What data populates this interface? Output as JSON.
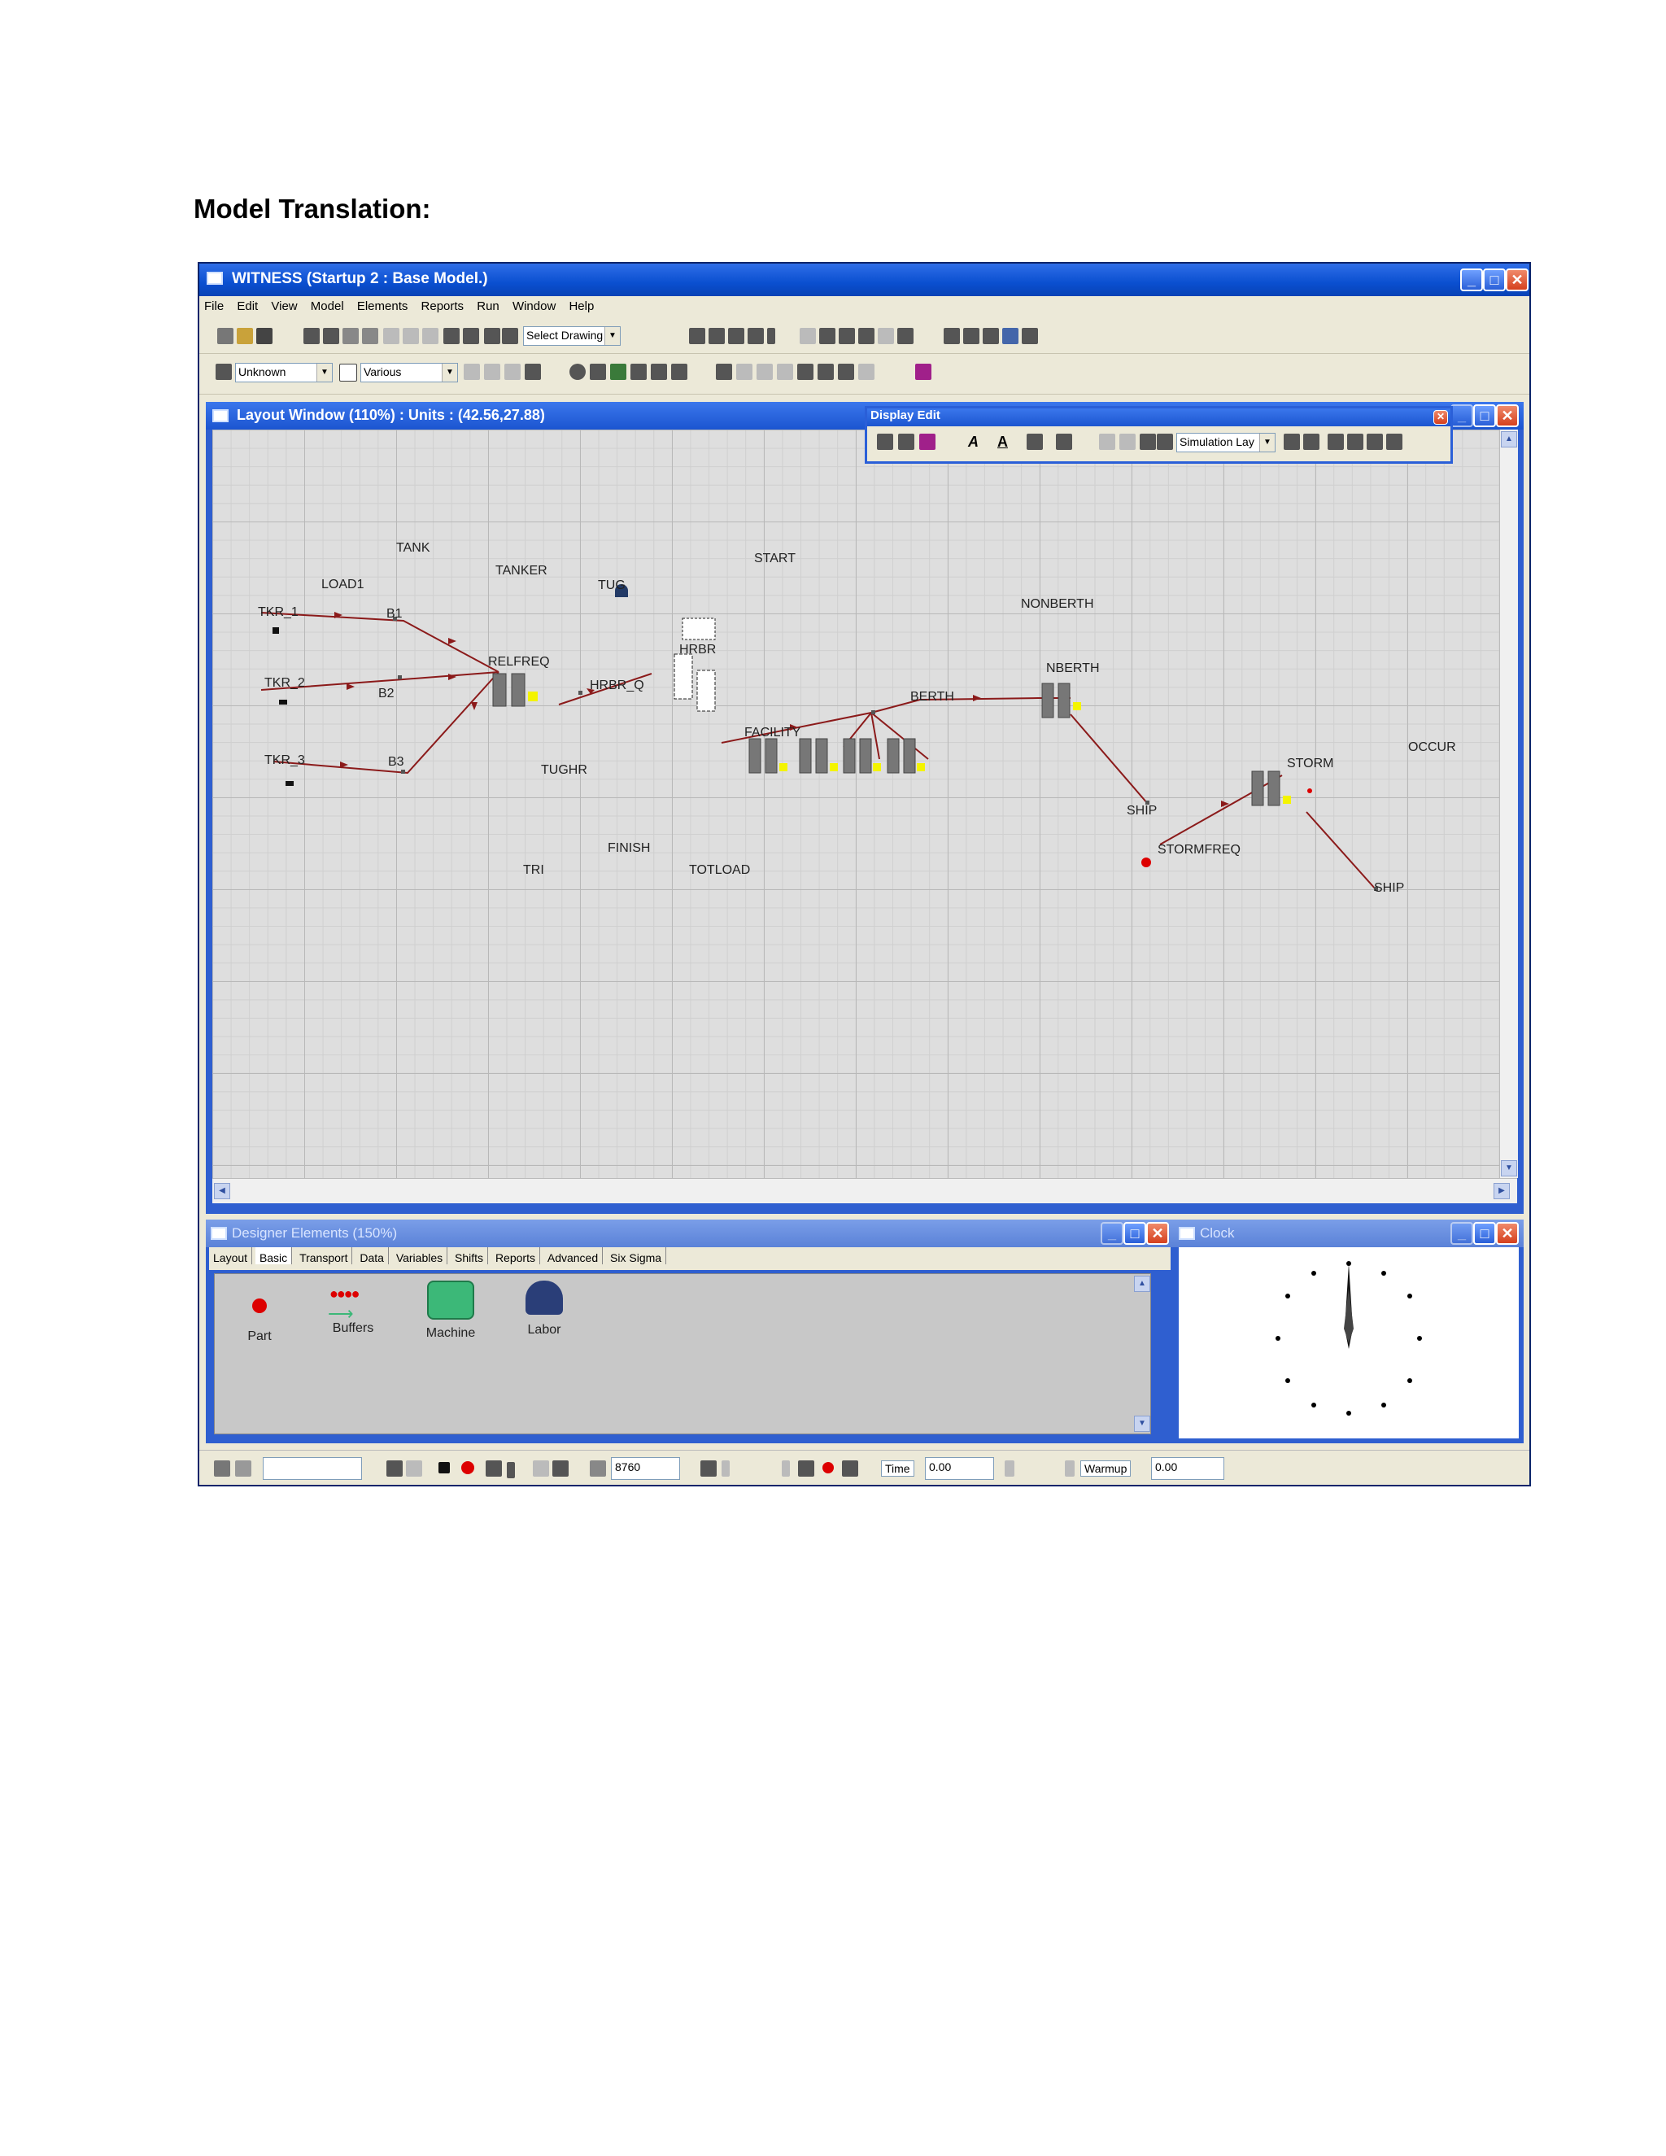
{
  "heading": "Model Translation:",
  "app": {
    "title": "WITNESS (Startup 2 : Base Model.)",
    "menu": [
      "File",
      "Edit",
      "View",
      "Model",
      "Elements",
      "Reports",
      "Run",
      "Window",
      "Help"
    ],
    "toolbar": {
      "drawing_select": "Select Drawing",
      "unit_select": "Unknown",
      "various_select": "Various"
    }
  },
  "layout_window": {
    "title": "Layout Window (110%) : Units : (42.56,27.88)",
    "labels": [
      "TANK",
      "LOAD1",
      "TANKER",
      "TUG",
      "START",
      "NONBERTH",
      "TKR_1",
      "B1",
      "RELFREQ",
      "HRBR",
      "NBERTH",
      "TKR_2",
      "B2",
      "HRBR_Q",
      "BERTH",
      "FACILITY",
      "OCCUR",
      "TKR_3",
      "B3",
      "TUGHR",
      "STORM",
      "SHIP",
      "STORMFREQ",
      "FINISH",
      "TRI",
      "TOTLOAD",
      "SHIP"
    ]
  },
  "display_edit": {
    "title": "Display Edit",
    "layer_select": "Simulation Lay"
  },
  "designer": {
    "title": "Designer Elements (150%)",
    "tabs": [
      "Layout",
      "Basic",
      "Transport",
      "Data",
      "Variables",
      "Shifts",
      "Reports",
      "Advanced",
      "Six Sigma"
    ],
    "items": [
      "Part",
      "Buffers",
      "Machine",
      "Labor"
    ]
  },
  "clock": {
    "title": "Clock"
  },
  "statusbar": {
    "run_length": "8760",
    "time_label": "Time",
    "time_value": "0.00",
    "warmup_label": "Warmup",
    "warmup_value": "0.00"
  },
  "colors": {
    "titlebar": "#0a4fd0",
    "link_line": "#8b1a1a",
    "part_red": "#dd0000",
    "machine_green": "#3cb878"
  }
}
